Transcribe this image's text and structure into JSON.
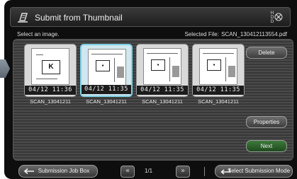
{
  "header": {
    "title": "Submit from Thumbnail",
    "hdd_label": "HDD"
  },
  "info": {
    "instruction": "Select an image.",
    "selected_file_label": "Selected File:",
    "selected_file_value": "SCAN_130412113554.pdf"
  },
  "thumbnails": [
    {
      "time": "04/12 11:36",
      "name": "SCAN_13041211",
      "mark": "K",
      "selected": false
    },
    {
      "time": "04/12 11:35",
      "name": "SCAN_13041211",
      "mark": "",
      "selected": true
    },
    {
      "time": "04/12 11:35",
      "name": "SCAN_13041211",
      "mark": "",
      "selected": false
    },
    {
      "time": "04/12 11:35",
      "name": "SCAN_13041211",
      "mark": "",
      "selected": false
    }
  ],
  "actions": {
    "delete": "Delete",
    "properties": "Properties",
    "next": "Next"
  },
  "footer": {
    "back": "Submission Job Box",
    "prev_icon": "double-chevron-left",
    "page_indicator": "1/1",
    "next_icon": "double-chevron-right",
    "mode": "Select Submission Mode"
  },
  "colors": {
    "selected_border": "#7fd0e6",
    "next_button": "#3d7a3a"
  }
}
